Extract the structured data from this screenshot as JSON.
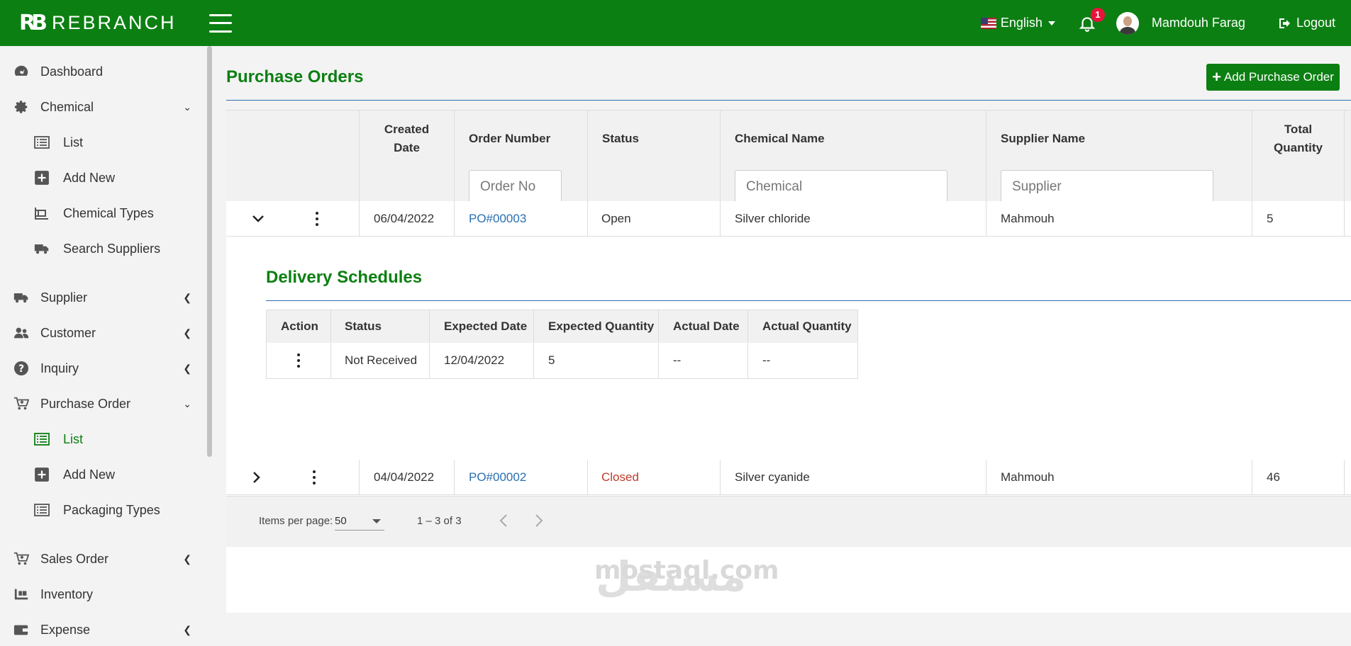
{
  "brand": {
    "logo_mark": "RB",
    "name": "REBRANCH"
  },
  "header": {
    "language": "English",
    "notification_count": "1",
    "user_name": "Mamdouh Farag",
    "logout_label": "Logout"
  },
  "sidebar": {
    "items": [
      {
        "label": "Dashboard",
        "icon": "dashboard-icon"
      },
      {
        "label": "Chemical",
        "icon": "gear-icon",
        "expanded": true
      },
      {
        "label": "List",
        "icon": "list-icon"
      },
      {
        "label": "Add New",
        "icon": "plus-square-icon"
      },
      {
        "label": "Chemical Types",
        "icon": "types-icon"
      },
      {
        "label": "Search Suppliers",
        "icon": "truck-icon"
      },
      {
        "label": "Supplier",
        "icon": "truck-icon"
      },
      {
        "label": "Customer",
        "icon": "users-icon"
      },
      {
        "label": "Inquiry",
        "icon": "question-icon"
      },
      {
        "label": "Purchase Order",
        "icon": "cart-icon",
        "expanded": true
      },
      {
        "label": "List",
        "icon": "list-icon",
        "active": true
      },
      {
        "label": "Add New",
        "icon": "plus-square-icon"
      },
      {
        "label": "Packaging Types",
        "icon": "list-icon"
      },
      {
        "label": "Sales Order",
        "icon": "cart-icon"
      },
      {
        "label": "Inventory",
        "icon": "pallet-icon"
      },
      {
        "label": "Expense",
        "icon": "wallet-icon"
      }
    ]
  },
  "main": {
    "title": "Purchase Orders",
    "add_button_label": "Add Purchase Order",
    "columns": {
      "created_date_1": "Created",
      "created_date_2": "Date",
      "order_number": "Order Number",
      "status": "Status",
      "chemical_name": "Chemical Name",
      "supplier_name": "Supplier Name",
      "total_qty_1": "Total",
      "total_qty_2": "Quantity"
    },
    "filters": {
      "order_no_placeholder": "Order No",
      "chemical_placeholder": "Chemical",
      "supplier_placeholder": "Supplier"
    },
    "rows": [
      {
        "created": "06/04/2022",
        "order_no": "PO#00003",
        "status": "Open",
        "chemical": "Silver chloride",
        "supplier": "Mahmouh",
        "total": "5",
        "expanded": true
      },
      {
        "created": "04/04/2022",
        "order_no": "PO#00002",
        "status": "Closed",
        "chemical": "Silver cyanide",
        "supplier": "Mahmouh",
        "total": "46",
        "expanded": false
      }
    ],
    "delivery": {
      "title": "Delivery Schedules",
      "columns": {
        "action": "Action",
        "status": "Status",
        "expected_date": "Expected Date",
        "expected_qty": "Expected Quantity",
        "actual_date": "Actual Date",
        "actual_qty": "Actual Quantity"
      },
      "rows": [
        {
          "status": "Not Received",
          "expected_date": "12/04/2022",
          "expected_qty": "5",
          "actual_date": "--",
          "actual_qty": "--"
        }
      ]
    },
    "paginator": {
      "items_per_page_label": "Items per page:",
      "page_size": "50",
      "range": "1 – 3 of 3"
    }
  },
  "watermark": {
    "text": "mostaql.com",
    "arabic": "مستقل"
  },
  "colors": {
    "brand_green": "#0c7f12",
    "link_blue": "#2a6fb0",
    "status_red": "#c0392b",
    "badge_red": "#e8133b"
  }
}
